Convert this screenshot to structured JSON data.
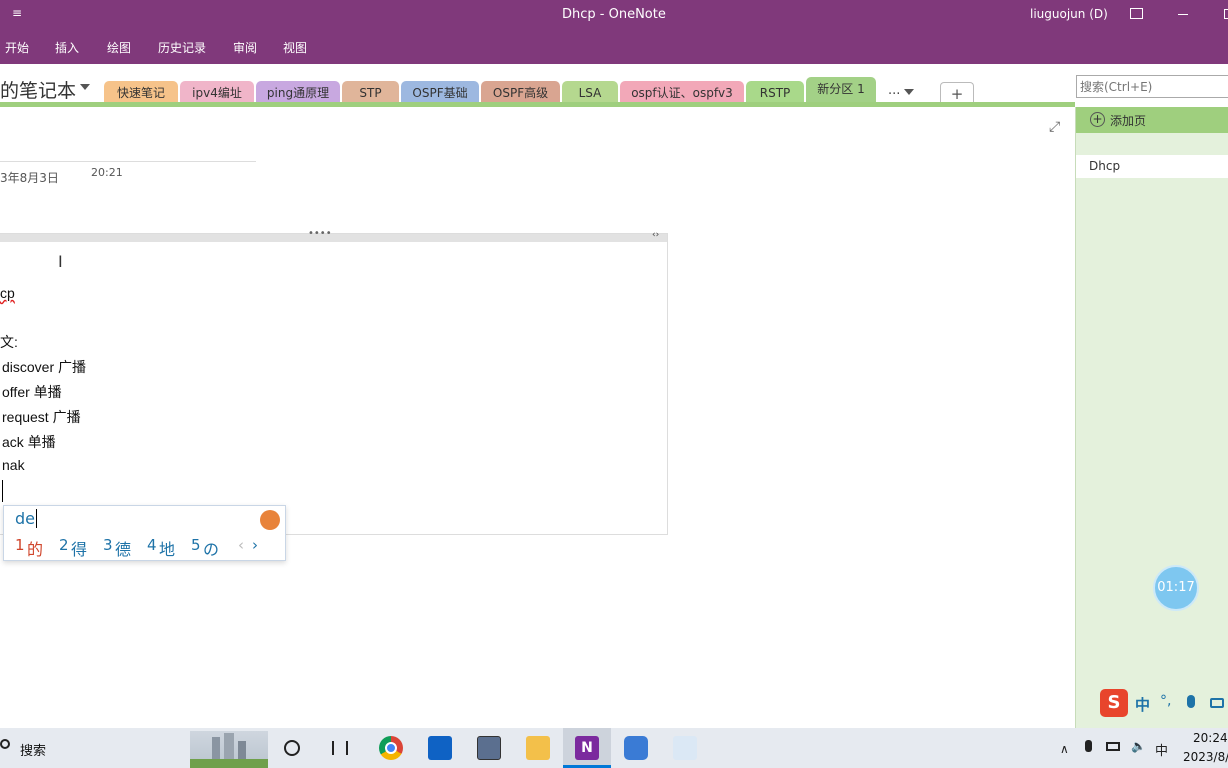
{
  "window": {
    "title": "Dhcp  -  OneNote",
    "user": "liuguojun (D)",
    "quick_access": "≡"
  },
  "ribbon": {
    "tabs": [
      "开始",
      "插入",
      "绘图",
      "历史记录",
      "审阅",
      "视图"
    ]
  },
  "notebook": {
    "name": "的笔记本",
    "sections": [
      {
        "label": "快速笔记",
        "color": "#f6c38a"
      },
      {
        "label": "ipv4编址",
        "color": "#f0b5c9"
      },
      {
        "label": "ping通原理",
        "color": "#c8a8e0"
      },
      {
        "label": "STP",
        "color": "#e0b59a"
      },
      {
        "label": "OSPF基础",
        "color": "#9db8e0"
      },
      {
        "label": "OSPF高级",
        "color": "#d9a591"
      },
      {
        "label": "LSA",
        "color": "#b5d88f"
      },
      {
        "label": "ospf认证、ospfv3",
        "color": "#f2a8b8"
      },
      {
        "label": "RSTP",
        "color": "#a9d98a"
      },
      {
        "label": "新分区 1",
        "color": "#a3d187"
      }
    ],
    "more_label": "...",
    "add_label": "+"
  },
  "search": {
    "placeholder": "搜索(Ctrl+E)"
  },
  "pages_pane": {
    "add_page_label": "添加页",
    "pages": [
      "Dhcp"
    ]
  },
  "page": {
    "date": "3年8月3日",
    "time": "20:21",
    "lines": [
      "cp",
      "文:",
      "discover 广播",
      "offer 单播",
      "request 广播",
      "ack 单播",
      "nak"
    ]
  },
  "ime": {
    "input": "de",
    "candidates": [
      {
        "num": "1",
        "char": "的"
      },
      {
        "num": "2",
        "char": "得"
      },
      {
        "num": "3",
        "char": "德"
      },
      {
        "num": "4",
        "char": "地"
      },
      {
        "num": "5",
        "char": "の"
      }
    ],
    "prev": "‹",
    "next": "›",
    "toolbar_lang": "中",
    "toolbar_punct": "°,"
  },
  "timer": {
    "value": "01:17"
  },
  "taskbar": {
    "search_label": "搜索",
    "time": "20:24",
    "date": "2023/8/",
    "ime_lang": "中",
    "colors": {
      "chrome": "#4285f4",
      "outlook": "#0f62c4",
      "hdx": "#5b6f8f",
      "explorer": "#f3c04a",
      "onenote": "#7b2a9e",
      "app": "#3a7bd5"
    }
  }
}
